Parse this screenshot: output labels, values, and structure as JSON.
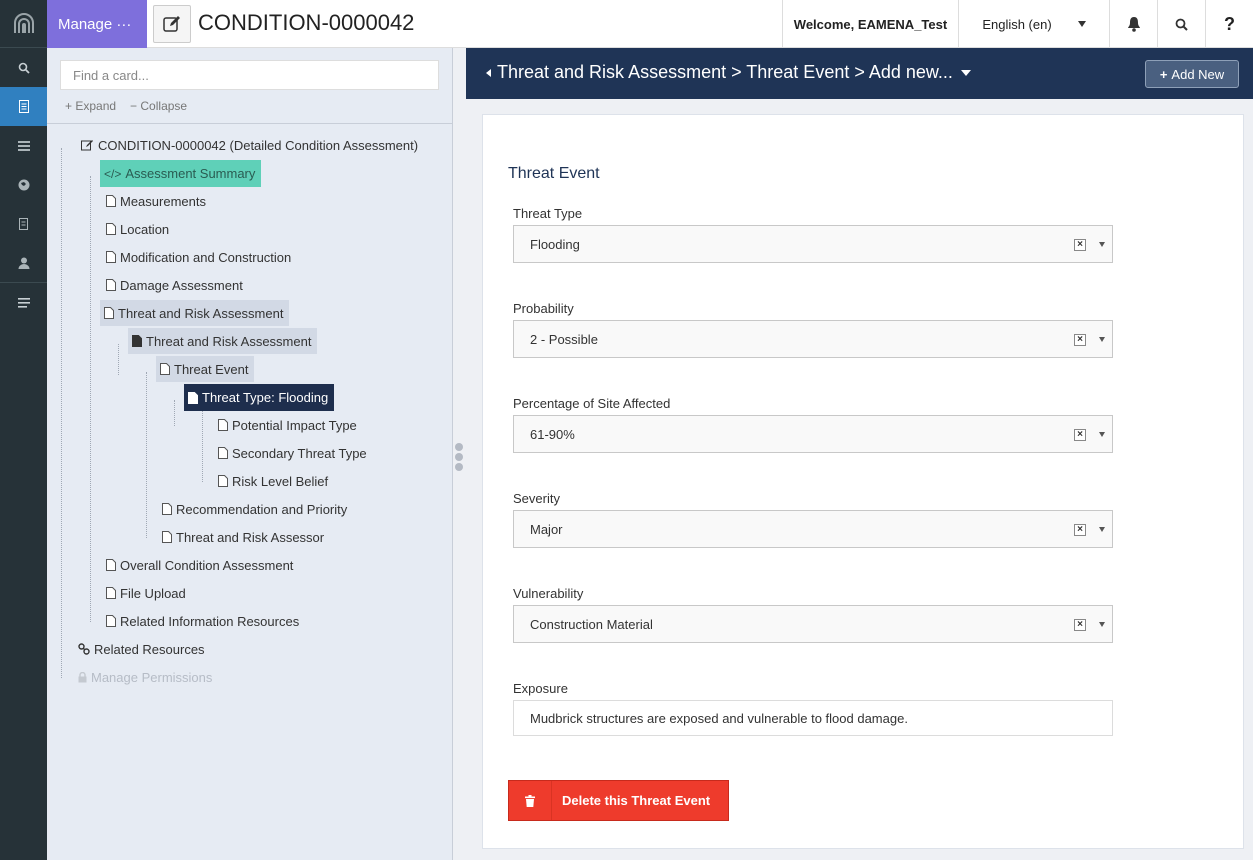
{
  "rail": {
    "icons": [
      "arches-logo",
      "search-icon",
      "resource-editor-icon",
      "list-icon",
      "globe-icon",
      "bookmark-icon",
      "user-icon",
      "menu-icon"
    ]
  },
  "topbar": {
    "manage_label": "Manage ···",
    "resource_title": "CONDITION-0000042",
    "welcome": "Welcome, EAMENA_Test",
    "language": "English (en)",
    "help": "?"
  },
  "tree": {
    "search_placeholder": "Find a card...",
    "expand_label": "Expand",
    "collapse_label": "Collapse",
    "root_label": "CONDITION-0000042 (Detailed Condition Assessment)",
    "nodes": {
      "assessment_summary": "Assessment Summary",
      "measurements": "Measurements",
      "location": "Location",
      "modification": "Modification and Construction",
      "damage": "Damage Assessment",
      "threat_risk": "Threat and Risk Assessment",
      "threat_risk_child": "Threat and Risk Assessment",
      "threat_event": "Threat Event",
      "threat_type_flooding": "Threat Type: Flooding",
      "potential_impact": "Potential Impact Type",
      "secondary_threat": "Secondary Threat Type",
      "risk_level": "Risk Level Belief",
      "recommendation": "Recommendation and Priority",
      "assessor": "Threat and Risk Assessor",
      "overall_condition": "Overall Condition Assessment",
      "file_upload": "File Upload",
      "related_info": "Related Information Resources",
      "related_resources": "Related Resources",
      "manage_permissions": "Manage Permissions"
    }
  },
  "header": {
    "breadcrumb": "Threat and Risk Assessment > Threat Event > Add new...",
    "add_new_label": "Add New"
  },
  "form": {
    "title": "Threat Event",
    "fields": {
      "threat_type": {
        "label": "Threat Type",
        "value": "Flooding"
      },
      "probability": {
        "label": "Probability",
        "value": "2 - Possible"
      },
      "percentage": {
        "label": "Percentage of Site Affected",
        "value": "61-90%"
      },
      "severity": {
        "label": "Severity",
        "value": "Major"
      },
      "vulnerability": {
        "label": "Vulnerability",
        "value": "Construction Material"
      },
      "exposure": {
        "label": "Exposure",
        "value": "Mudbrick structures are exposed and vulnerable to flood damage."
      }
    },
    "delete_label": "Delete this Threat Event"
  },
  "colors": {
    "rail": "#263238",
    "manage": "#7e6fdc",
    "header": "#1f3456",
    "selected_node": "#1e2e4d",
    "highlight_node": "#5fd0b8",
    "delete": "#ee3b2c"
  }
}
